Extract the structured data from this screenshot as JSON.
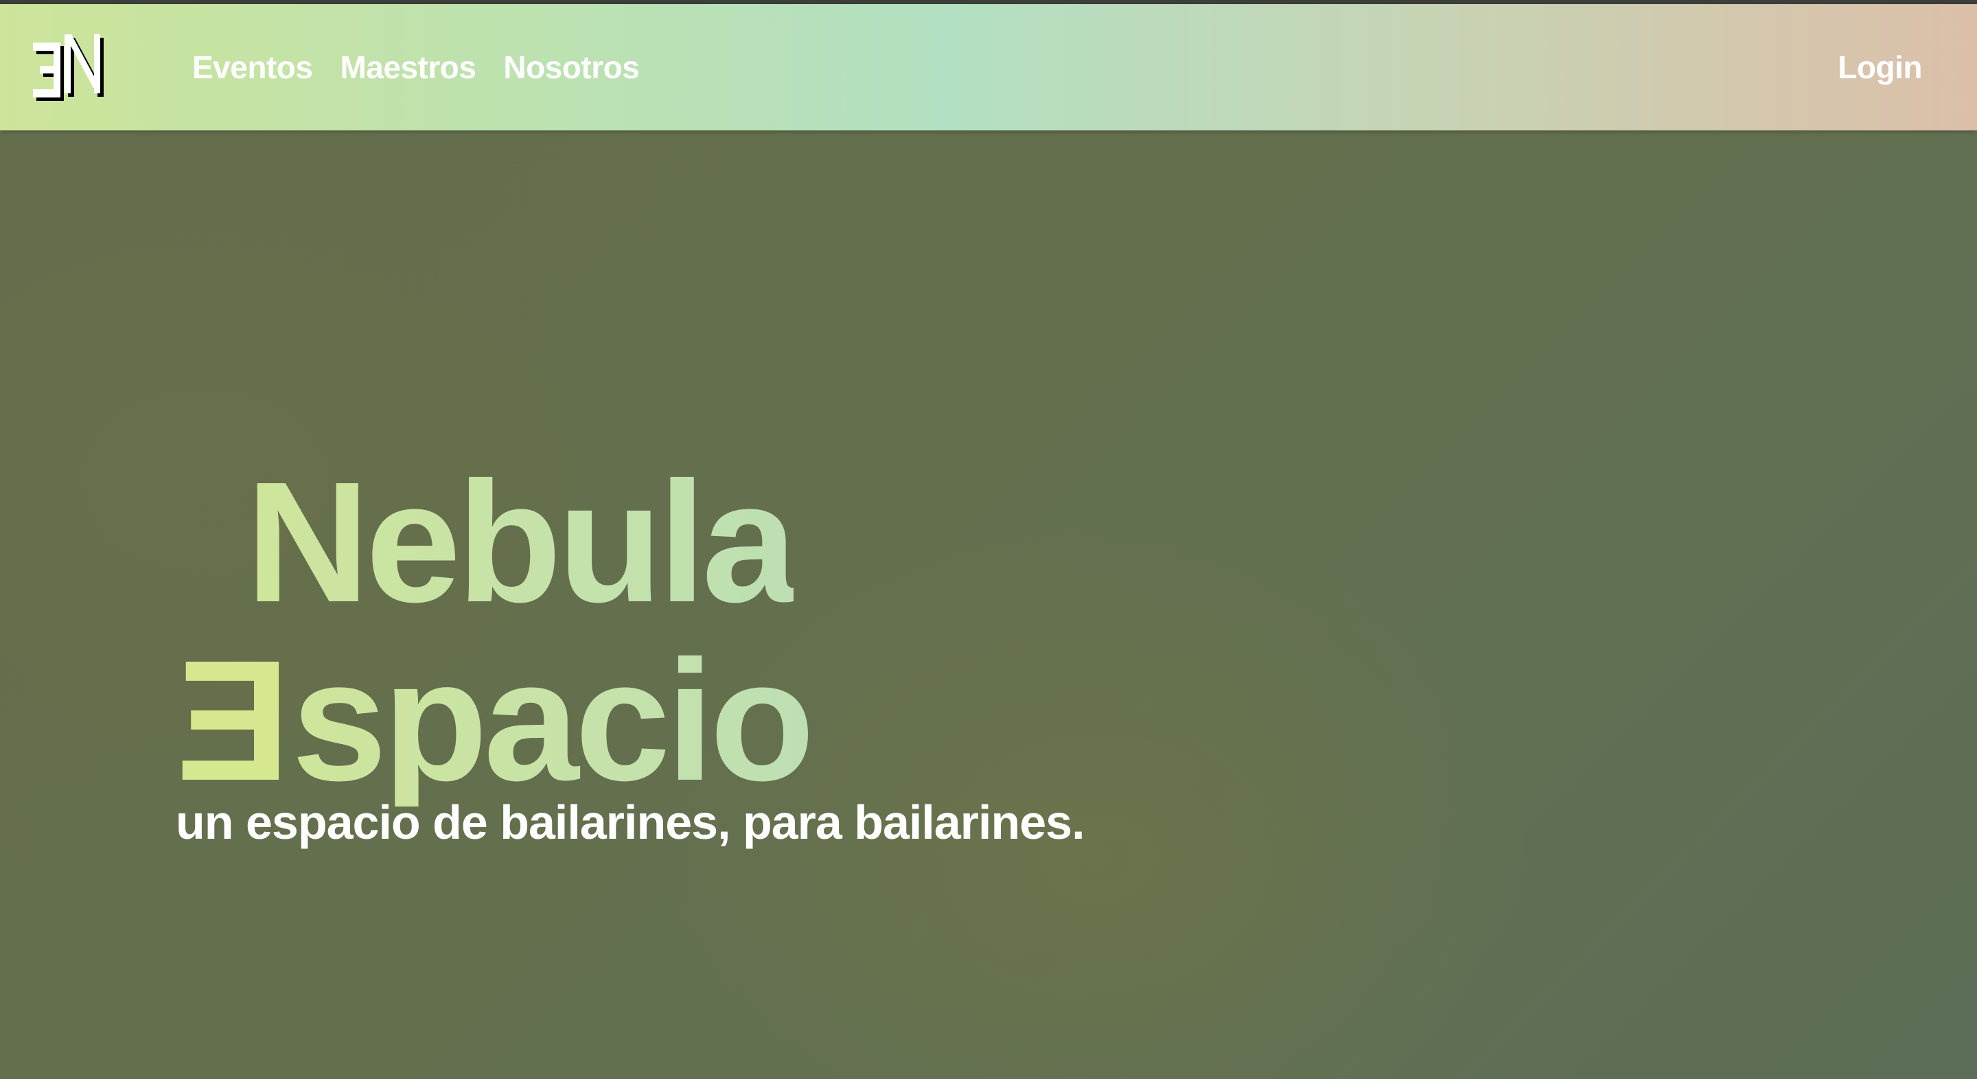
{
  "navbar": {
    "logo_text": "EN",
    "links": [
      "Eventos",
      "Maestros",
      "Nosotros"
    ],
    "login_label": "Login"
  },
  "hero": {
    "title_line1": "Nebula",
    "title_line2_first_letter": "E",
    "title_line2_rest": "spacio",
    "tagline": "un espacio de bailarines, para bailarines."
  },
  "colors": {
    "navbar_gradient": [
      "#cde49a",
      "#b3e0c2",
      "#dcbfa9"
    ],
    "hero_background": "#646f4d",
    "title_accent": "#cfe59b",
    "text_white": "#ffffff"
  }
}
